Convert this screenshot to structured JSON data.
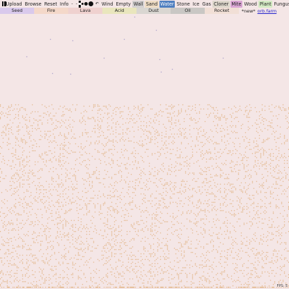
{
  "toolbar": {
    "pause_icon": "pause-icon",
    "buttons": {
      "upload": "Upload",
      "browse": "Browse",
      "reset": "Reset",
      "info": "Info"
    },
    "size_minus": "-",
    "size_plus": "-",
    "undo_glyph": "↶",
    "elements": {
      "wind": "Wind",
      "empty": "Empty",
      "wall": "Wall",
      "sand": "Sand",
      "water": "Water",
      "stone": "Stone",
      "ice": "Ice",
      "gas": "Gas",
      "cloner": "Cloner",
      "mite": "Mite",
      "wood": "Wood",
      "plant": "Plant",
      "fungus": "Fungus"
    },
    "selected_element": "Water"
  },
  "row2": {
    "elements": [
      {
        "label": "Seed",
        "color": "#d9c9ec"
      },
      {
        "label": "Fire",
        "color": "#f4d8c9"
      },
      {
        "label": "Lava",
        "color": "#efd1cf"
      },
      {
        "label": "Acid",
        "color": "#e9e6bd"
      },
      {
        "label": "Dust",
        "color": "#d9d6d1"
      },
      {
        "label": "Oil",
        "color": "#c9c7c4"
      },
      {
        "label": "Rocket",
        "color": "#f1dfd6"
      }
    ],
    "new_label": "*new*",
    "orb_link": "orb.farm"
  },
  "colors": {
    "background": "#f4e6e6",
    "sand": "#d89a52",
    "water": "#4f7fc0",
    "particle": "#7a72b8"
  },
  "fps_label": "FPS: 5"
}
